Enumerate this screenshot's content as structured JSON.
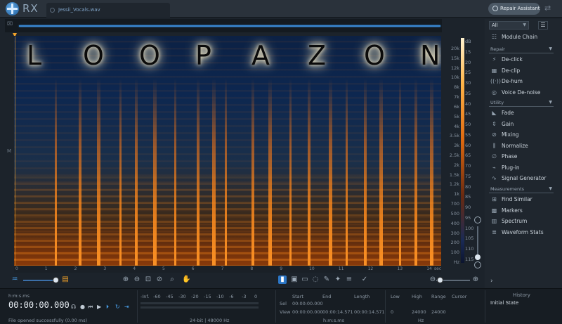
{
  "app": {
    "name": "RX",
    "file_tab": "Jessii_Vocals.wav",
    "repair_assistant": "Repair Assistant"
  },
  "overlay_text": [
    "L",
    "O",
    "O",
    "P",
    "A",
    "Z",
    "O",
    "N"
  ],
  "channel_label": "M",
  "time_ticks": [
    "0",
    "1",
    "2",
    "3",
    "4",
    "5",
    "6",
    "7",
    "8",
    "9",
    "10",
    "11",
    "12",
    "13",
    "14",
    "sec"
  ],
  "freq_ticks": [
    "20k",
    "15k",
    "12k",
    "10k",
    "8k",
    "7k",
    "6k",
    "5k",
    "4k",
    "3.5k",
    "3k",
    "2.5k",
    "2k",
    "1.5k",
    "1.2k",
    "1k",
    "700",
    "500",
    "400",
    "300",
    "200",
    "100",
    "Hz"
  ],
  "db_ticks": [
    "dB",
    "15",
    "20",
    "25",
    "30",
    "35",
    "40",
    "45",
    "50",
    "55",
    "60",
    "65",
    "70",
    "75",
    "80",
    "85",
    "90",
    "95",
    "100",
    "105",
    "110",
    "115"
  ],
  "sidebar": {
    "filter": "All",
    "module_chain": "Module Chain",
    "repair_heading": "Repair",
    "repair_items": [
      "De-click",
      "De-clip",
      "De-hum",
      "Voice De-noise"
    ],
    "utility_heading": "Utility",
    "utility_items": [
      "Fade",
      "Gain",
      "Mixing",
      "Normalize",
      "Phase",
      "Plug-in",
      "Signal Generator"
    ],
    "measurements_heading": "Measurements",
    "measurement_items": [
      "Find Similar",
      "Markers",
      "Spectrum",
      "Waveform Stats"
    ]
  },
  "bottom": {
    "format": "h:m:s.ms",
    "timecode": "00:00:00.000",
    "status": "File opened successfully (0.00 ms)",
    "meter_ticks": [
      "-Inf.",
      "-60",
      "-45",
      "-30",
      "-20",
      "-15",
      "-10",
      "-6",
      "-3",
      "0"
    ],
    "bit_info": "24-bit | 48000 Hz",
    "selection": {
      "start_label": "Start",
      "end_label": "End",
      "length_label": "Length",
      "sel_label": "Sel",
      "view_label": "View",
      "sel_start": "00:00:00.000",
      "view_start": "00:00:00.000",
      "view_end": "00:00:14.571",
      "view_length": "00:00:14.571",
      "unit": "h:m:s.ms"
    },
    "freq": {
      "low_label": "Low",
      "high_label": "High",
      "range_label": "Range",
      "cursor_label": "Cursor",
      "view_low": "0",
      "view_high": "24000",
      "view_range": "24000",
      "unit": "Hz"
    },
    "history_title": "History",
    "history_entry": "Initial State"
  }
}
